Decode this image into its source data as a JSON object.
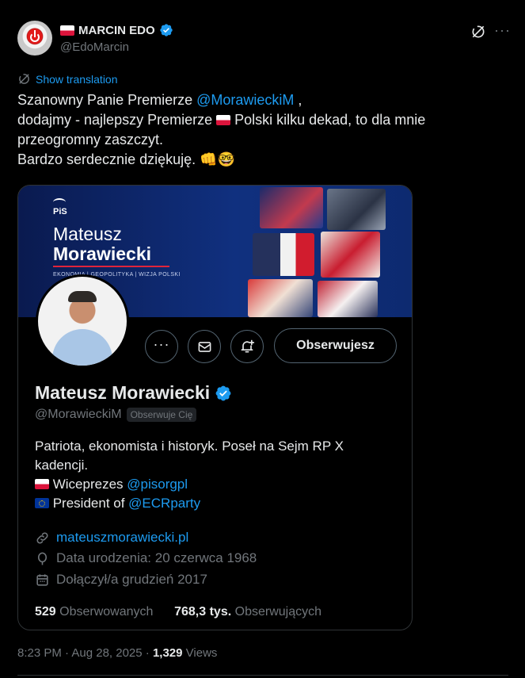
{
  "author": {
    "name": "MARCIN EDO",
    "handle": "@EdoMarcin",
    "avatar_icon": "power-button-icon",
    "flag_icon": "poland-flag-icon",
    "verified_icon": "verified-badge-icon"
  },
  "actions": {
    "grok_icon": "grok-icon",
    "more_icon": "more-icon"
  },
  "show_translation": "Show translation",
  "tweet": {
    "line1_pre": "Szanowny Panie Premierze ",
    "line1_mention": "@MorawieckiM",
    "line1_post": " ,",
    "line2_pre": "dodajmy - najlepszy Premierze ",
    "line2_post": " Polski kilku dekad, to dla mnie",
    "line3": "przeogromny zaszczyt.",
    "line4": "Bardzo serdecznie dziękuję. 👊🤓"
  },
  "card": {
    "banner": {
      "logo": "PiS",
      "first_name": "Mateusz",
      "last_name": "Morawiecki",
      "tagline": "EKONOMIA | GEOPOLITYKA | WIZJA POLSKI"
    },
    "follow_button": "Obserwujesz",
    "name": "Mateusz Morawiecki",
    "handle": "@MorawieckiM",
    "follows_you": "Obserwuje Cię",
    "bio_line1": "Patriota, ekonomista i historyk. Poseł na Sejm RP X",
    "bio_line2": "kadencji.",
    "bio_line3_text": " Wiceprezes ",
    "bio_line3_mention": "@pisorgpl",
    "bio_line4_text": " President of ",
    "bio_line4_mention": "@ECRparty",
    "website": "mateuszmorawiecki.pl",
    "birthday": "Data urodzenia: 20 czerwca 1968",
    "joined": "Dołączył/a grudzień 2017",
    "following_count": "529",
    "following_label": "Obserwowanych",
    "followers_count": "768,3 tys.",
    "followers_label": "Obserwujących"
  },
  "timestamp": {
    "time": "8:23 PM · Aug 28, 2025 · ",
    "views_count": "1,329",
    "views_label": " Views"
  },
  "colors": {
    "background": "#000000",
    "text": "#e7e9ea",
    "muted": "#71767b",
    "accent": "#1d9bf0"
  }
}
